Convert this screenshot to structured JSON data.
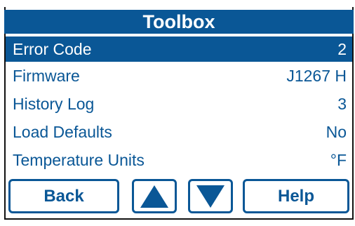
{
  "title": "Toolbox",
  "rows": [
    {
      "label": "Error Code",
      "value": "2"
    },
    {
      "label": "Firmware",
      "value": "J1267 H"
    },
    {
      "label": "History Log",
      "value": "3"
    },
    {
      "label": "Load Defaults",
      "value": "No"
    },
    {
      "label": "Temperature Units",
      "value": "°F"
    }
  ],
  "selected_row": "Error Code",
  "buttons": {
    "back": "Back",
    "up_icon": "up-arrow-icon",
    "down_icon": "down-arrow-icon",
    "help": "Help"
  },
  "colors": {
    "accent": "#0a5796",
    "background": "#ffffff",
    "text_selected": "#ffffff"
  }
}
